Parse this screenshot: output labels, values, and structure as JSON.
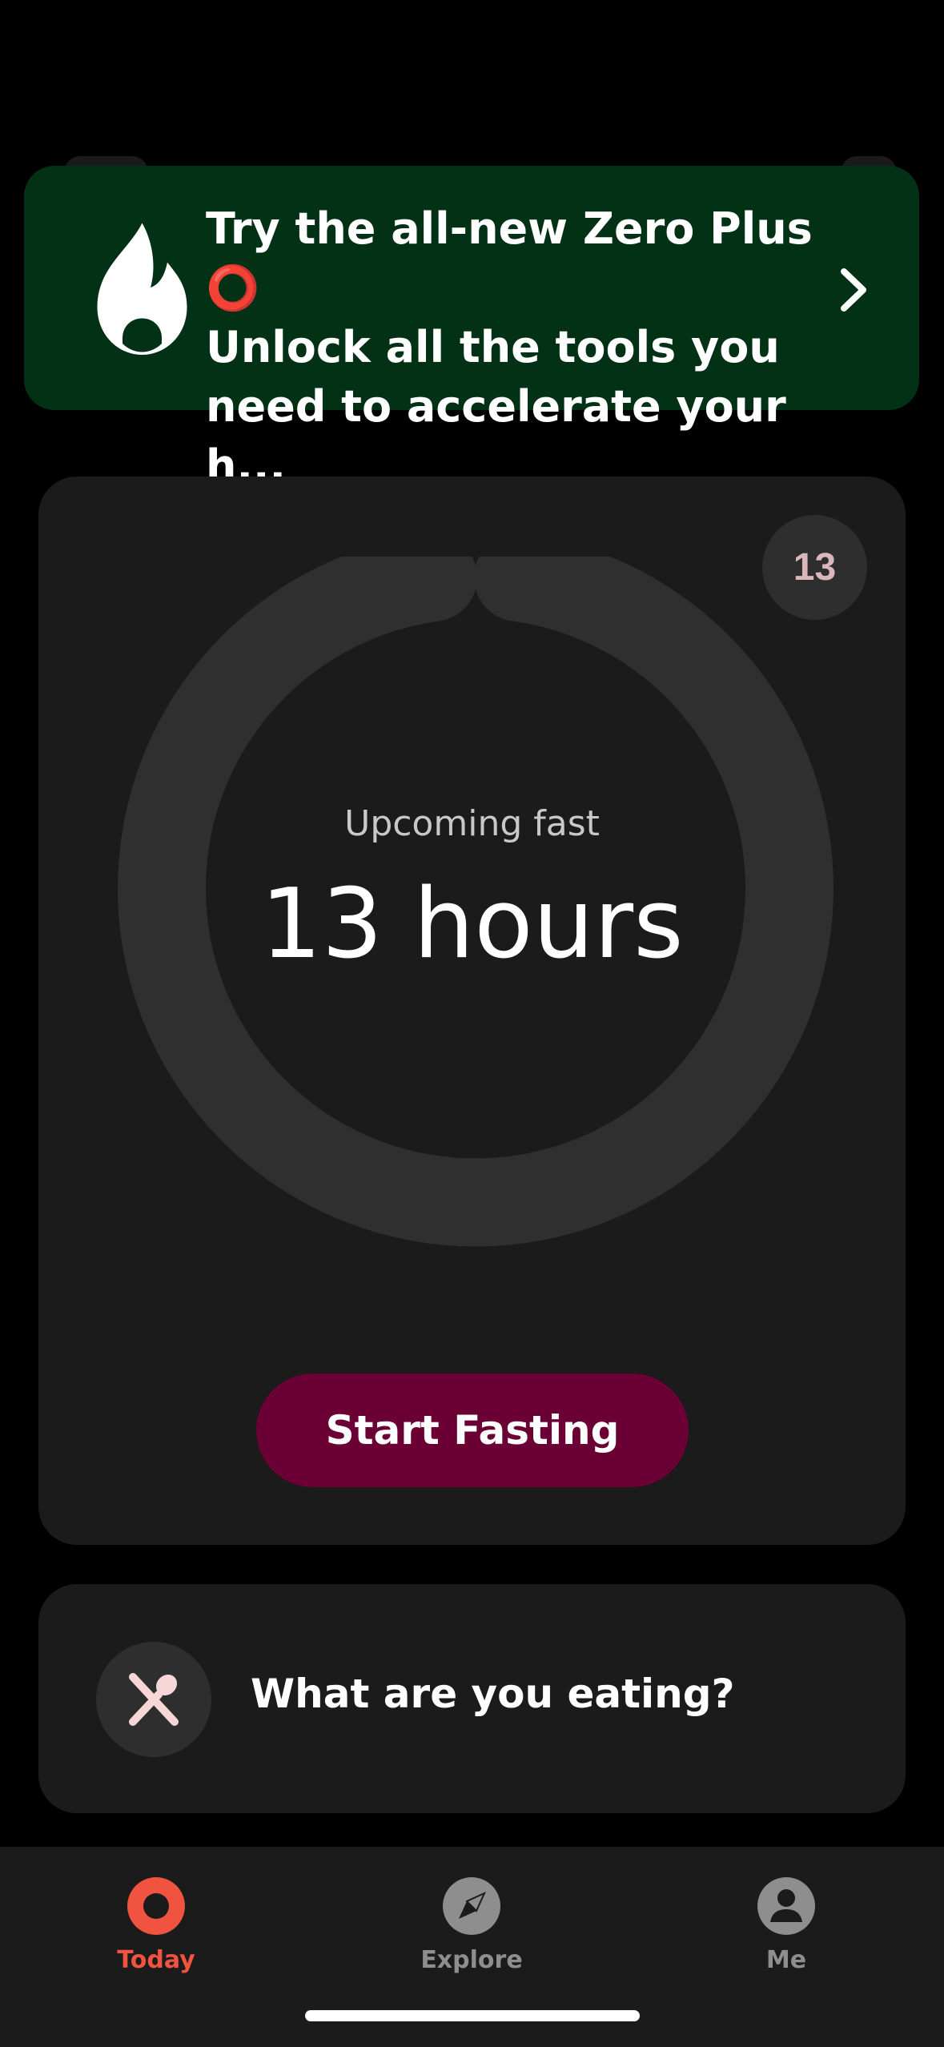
{
  "promo": {
    "text": "Try the all-new Zero Plus ⭕\nUnlock all the tools you\nneed to accelerate your h...",
    "icon": "flame-icon",
    "chevron_icon": "chevron-right-icon"
  },
  "fast_card": {
    "day_badge": "13",
    "upcoming_label": "Upcoming fast",
    "duration": "13 hours",
    "start_button": "Start Fasting"
  },
  "eating_card": {
    "icon": "utensils-icon",
    "label": "What are you eating?"
  },
  "nav": {
    "items": [
      {
        "label": "Today",
        "icon": "zero-ring-icon",
        "active": true
      },
      {
        "label": "Explore",
        "icon": "compass-icon",
        "active": false
      },
      {
        "label": "Me",
        "icon": "profile-icon",
        "active": false
      }
    ]
  },
  "colors": {
    "accent": "#f0533f",
    "promo_bg": "#023115",
    "button_bg": "#6a0033",
    "card_bg": "#1b1b1b",
    "inactive": "#8e8e8e"
  }
}
